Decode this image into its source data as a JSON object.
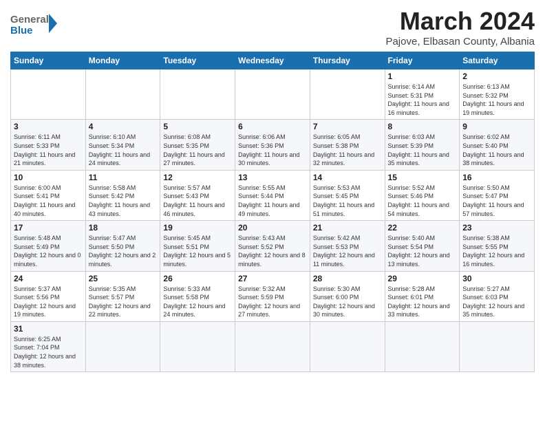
{
  "header": {
    "logo_general": "General",
    "logo_blue": "Blue",
    "month_year": "March 2024",
    "location": "Pajove, Elbasan County, Albania"
  },
  "days_of_week": [
    "Sunday",
    "Monday",
    "Tuesday",
    "Wednesday",
    "Thursday",
    "Friday",
    "Saturday"
  ],
  "weeks": [
    {
      "cells": [
        {
          "day": "",
          "info": ""
        },
        {
          "day": "",
          "info": ""
        },
        {
          "day": "",
          "info": ""
        },
        {
          "day": "",
          "info": ""
        },
        {
          "day": "",
          "info": ""
        },
        {
          "day": "1",
          "info": "Sunrise: 6:14 AM\nSunset: 5:31 PM\nDaylight: 11 hours and 16 minutes."
        },
        {
          "day": "2",
          "info": "Sunrise: 6:13 AM\nSunset: 5:32 PM\nDaylight: 11 hours and 19 minutes."
        }
      ]
    },
    {
      "cells": [
        {
          "day": "3",
          "info": "Sunrise: 6:11 AM\nSunset: 5:33 PM\nDaylight: 11 hours and 21 minutes."
        },
        {
          "day": "4",
          "info": "Sunrise: 6:10 AM\nSunset: 5:34 PM\nDaylight: 11 hours and 24 minutes."
        },
        {
          "day": "5",
          "info": "Sunrise: 6:08 AM\nSunset: 5:35 PM\nDaylight: 11 hours and 27 minutes."
        },
        {
          "day": "6",
          "info": "Sunrise: 6:06 AM\nSunset: 5:36 PM\nDaylight: 11 hours and 30 minutes."
        },
        {
          "day": "7",
          "info": "Sunrise: 6:05 AM\nSunset: 5:38 PM\nDaylight: 11 hours and 32 minutes."
        },
        {
          "day": "8",
          "info": "Sunrise: 6:03 AM\nSunset: 5:39 PM\nDaylight: 11 hours and 35 minutes."
        },
        {
          "day": "9",
          "info": "Sunrise: 6:02 AM\nSunset: 5:40 PM\nDaylight: 11 hours and 38 minutes."
        }
      ]
    },
    {
      "cells": [
        {
          "day": "10",
          "info": "Sunrise: 6:00 AM\nSunset: 5:41 PM\nDaylight: 11 hours and 40 minutes."
        },
        {
          "day": "11",
          "info": "Sunrise: 5:58 AM\nSunset: 5:42 PM\nDaylight: 11 hours and 43 minutes."
        },
        {
          "day": "12",
          "info": "Sunrise: 5:57 AM\nSunset: 5:43 PM\nDaylight: 11 hours and 46 minutes."
        },
        {
          "day": "13",
          "info": "Sunrise: 5:55 AM\nSunset: 5:44 PM\nDaylight: 11 hours and 49 minutes."
        },
        {
          "day": "14",
          "info": "Sunrise: 5:53 AM\nSunset: 5:45 PM\nDaylight: 11 hours and 51 minutes."
        },
        {
          "day": "15",
          "info": "Sunrise: 5:52 AM\nSunset: 5:46 PM\nDaylight: 11 hours and 54 minutes."
        },
        {
          "day": "16",
          "info": "Sunrise: 5:50 AM\nSunset: 5:47 PM\nDaylight: 11 hours and 57 minutes."
        }
      ]
    },
    {
      "cells": [
        {
          "day": "17",
          "info": "Sunrise: 5:48 AM\nSunset: 5:49 PM\nDaylight: 12 hours and 0 minutes."
        },
        {
          "day": "18",
          "info": "Sunrise: 5:47 AM\nSunset: 5:50 PM\nDaylight: 12 hours and 2 minutes."
        },
        {
          "day": "19",
          "info": "Sunrise: 5:45 AM\nSunset: 5:51 PM\nDaylight: 12 hours and 5 minutes."
        },
        {
          "day": "20",
          "info": "Sunrise: 5:43 AM\nSunset: 5:52 PM\nDaylight: 12 hours and 8 minutes."
        },
        {
          "day": "21",
          "info": "Sunrise: 5:42 AM\nSunset: 5:53 PM\nDaylight: 12 hours and 11 minutes."
        },
        {
          "day": "22",
          "info": "Sunrise: 5:40 AM\nSunset: 5:54 PM\nDaylight: 12 hours and 13 minutes."
        },
        {
          "day": "23",
          "info": "Sunrise: 5:38 AM\nSunset: 5:55 PM\nDaylight: 12 hours and 16 minutes."
        }
      ]
    },
    {
      "cells": [
        {
          "day": "24",
          "info": "Sunrise: 5:37 AM\nSunset: 5:56 PM\nDaylight: 12 hours and 19 minutes."
        },
        {
          "day": "25",
          "info": "Sunrise: 5:35 AM\nSunset: 5:57 PM\nDaylight: 12 hours and 22 minutes."
        },
        {
          "day": "26",
          "info": "Sunrise: 5:33 AM\nSunset: 5:58 PM\nDaylight: 12 hours and 24 minutes."
        },
        {
          "day": "27",
          "info": "Sunrise: 5:32 AM\nSunset: 5:59 PM\nDaylight: 12 hours and 27 minutes."
        },
        {
          "day": "28",
          "info": "Sunrise: 5:30 AM\nSunset: 6:00 PM\nDaylight: 12 hours and 30 minutes."
        },
        {
          "day": "29",
          "info": "Sunrise: 5:28 AM\nSunset: 6:01 PM\nDaylight: 12 hours and 33 minutes."
        },
        {
          "day": "30",
          "info": "Sunrise: 5:27 AM\nSunset: 6:03 PM\nDaylight: 12 hours and 35 minutes."
        }
      ]
    },
    {
      "cells": [
        {
          "day": "31",
          "info": "Sunrise: 6:25 AM\nSunset: 7:04 PM\nDaylight: 12 hours and 38 minutes."
        },
        {
          "day": "",
          "info": ""
        },
        {
          "day": "",
          "info": ""
        },
        {
          "day": "",
          "info": ""
        },
        {
          "day": "",
          "info": ""
        },
        {
          "day": "",
          "info": ""
        },
        {
          "day": "",
          "info": ""
        }
      ]
    }
  ]
}
